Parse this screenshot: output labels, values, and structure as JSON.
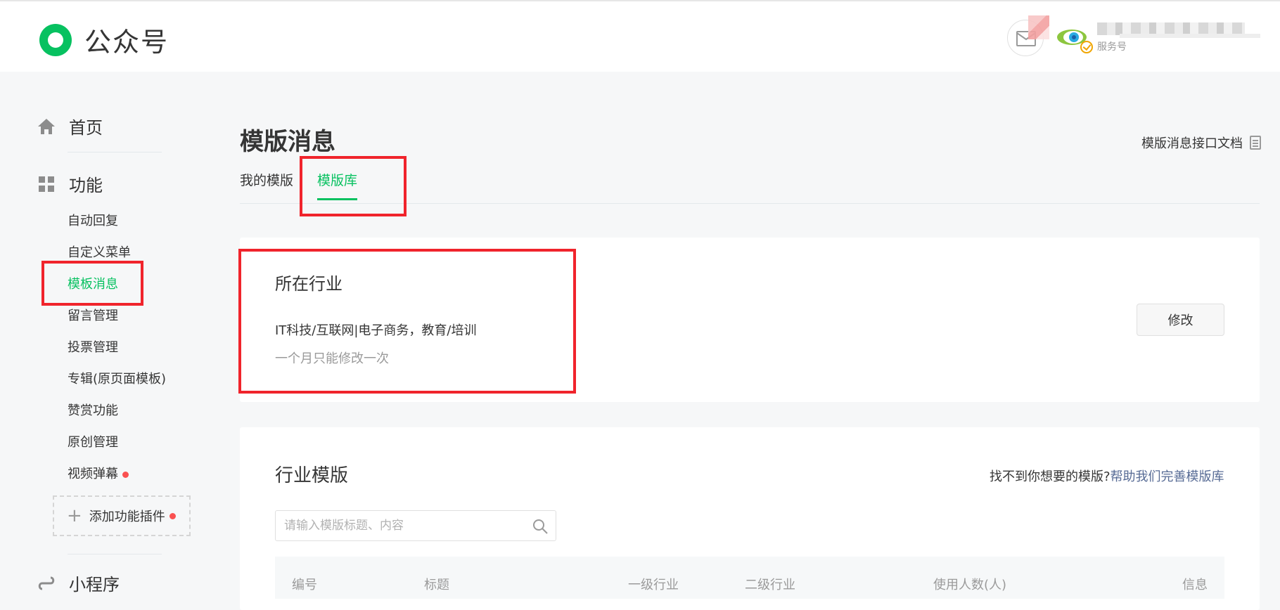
{
  "header": {
    "app_title": "公众号",
    "account_type": "服务号"
  },
  "sidebar": {
    "home_label": "首页",
    "features_label": "功能",
    "items": [
      {
        "label": "自动回复"
      },
      {
        "label": "自定义菜单"
      },
      {
        "label": "模板消息",
        "active": true
      },
      {
        "label": "留言管理"
      },
      {
        "label": "投票管理"
      },
      {
        "label": "专辑(原页面模板)"
      },
      {
        "label": "赞赏功能"
      },
      {
        "label": "原创管理"
      },
      {
        "label": "视频弹幕",
        "new": true
      }
    ],
    "add_plugin_label": "添加功能插件",
    "miniprogram_label": "小程序"
  },
  "main": {
    "page_title": "模版消息",
    "doc_link": "模版消息接口文档",
    "tabs": [
      {
        "label": "我的模版"
      },
      {
        "label": "模版库",
        "active": true
      }
    ],
    "industry": {
      "title": "所在行业",
      "value": "IT科技/互联网|电子商务，教育/培训",
      "tip": "一个月只能修改一次",
      "modify_label": "修改"
    },
    "templates": {
      "title": "行业模版",
      "help_prefix": "找不到你想要的模版?",
      "help_link": "帮助我们完善模版库",
      "search_placeholder": "请输入模版标题、内容",
      "columns": [
        "编号",
        "标题",
        "一级行业",
        "二级行业",
        "使用人数(人)",
        "信息"
      ]
    }
  },
  "colors": {
    "accent": "#07c160",
    "highlight": "#f0242c",
    "link": "#576b95"
  }
}
